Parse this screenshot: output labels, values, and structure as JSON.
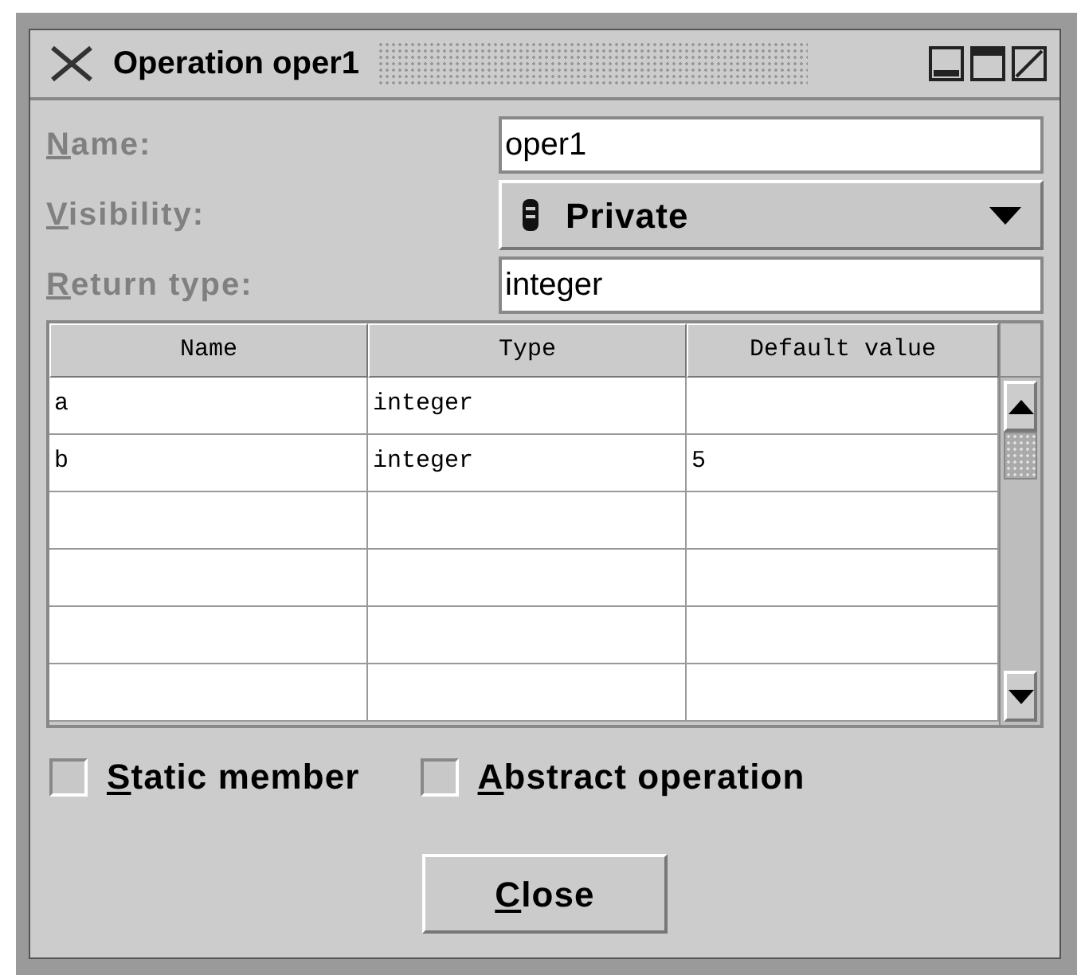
{
  "window": {
    "title": "Operation oper1"
  },
  "fields": [
    {
      "kind": "text",
      "label": {
        "mnemonic": "N",
        "rest": "ame:"
      },
      "value": "oper1"
    },
    {
      "kind": "combo",
      "label": {
        "mnemonic": "V",
        "rest": "isibility:"
      },
      "value": "Private"
    },
    {
      "kind": "text",
      "label": {
        "mnemonic": "R",
        "rest": "eturn type:"
      },
      "value": "integer"
    }
  ],
  "table": {
    "columns": [
      "Name",
      "Type",
      "Default value"
    ],
    "rows": [
      {
        "name": "a",
        "type": "integer"
      },
      {
        "name": "b",
        "type": "integer",
        "default_value": "5"
      },
      {},
      {},
      {},
      {}
    ]
  },
  "checkboxes": [
    {
      "label": {
        "mnemonic": "S",
        "rest": "tatic member"
      },
      "checked": false
    },
    {
      "label": {
        "mnemonic": "A",
        "rest": "bstract operation"
      },
      "checked": false
    }
  ],
  "buttons": [
    {
      "label": {
        "mnemonic": "C",
        "rest": "lose"
      }
    }
  ]
}
